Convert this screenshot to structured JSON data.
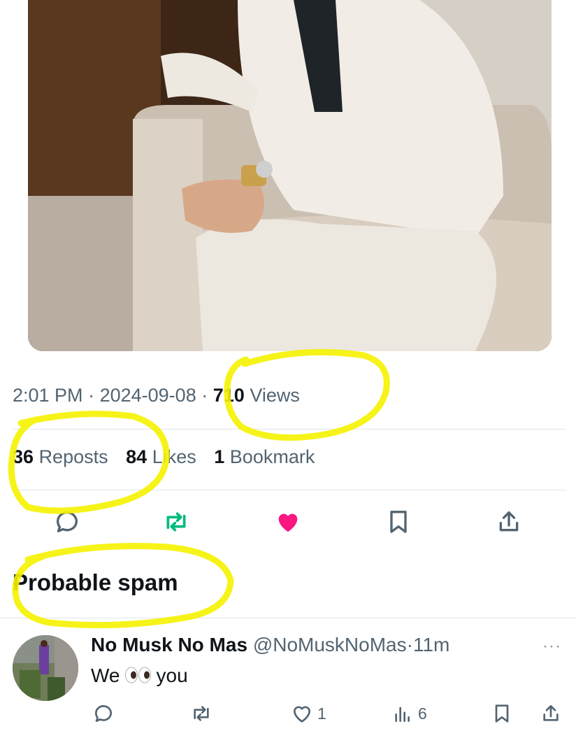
{
  "tweet": {
    "time": "2:01 PM",
    "date": "2024-09-08",
    "views_count": "710",
    "views_label": "Views",
    "separator": "·"
  },
  "stats": {
    "reposts_count": "36",
    "reposts_label": "Reposts",
    "likes_count": "84",
    "likes_label": "Likes",
    "bookmarks_count": "1",
    "bookmarks_label": "Bookmark"
  },
  "actions": {
    "reply_icon": "reply-icon",
    "repost_icon": "repost-icon",
    "like_icon": "heart-filled-icon",
    "bookmark_icon": "bookmark-icon",
    "share_icon": "share-icon"
  },
  "section": {
    "title": "Probable spam"
  },
  "reply": {
    "display_name": "No Musk No Mas",
    "handle": "@NoMuskNoMas",
    "separator": "·",
    "age": "11m",
    "text_before": "We",
    "text_after": "you",
    "emoji": "eyes-emoji",
    "more": "···",
    "likes": "1",
    "views": "6"
  },
  "colors": {
    "text": "#0f1419",
    "secondary": "#536471",
    "like": "#f91880",
    "repost": "#00ba7c",
    "highlight": "#f5f200"
  }
}
